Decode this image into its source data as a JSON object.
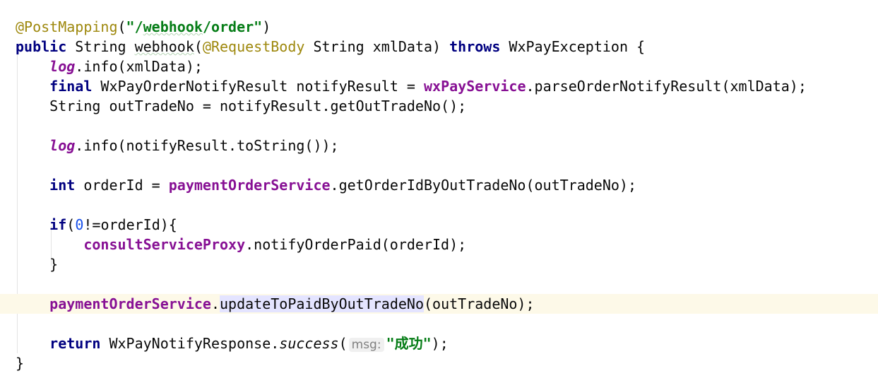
{
  "code": {
    "lines": [
      {
        "tokens": [
          {
            "t": "@PostMapping",
            "c": "ann"
          },
          {
            "t": "(",
            "c": ""
          },
          {
            "t": "\"/",
            "c": "str"
          },
          {
            "t": "webhook",
            "c": "str wavy"
          },
          {
            "t": "/order\"",
            "c": "str"
          },
          {
            "t": ")",
            "c": ""
          }
        ]
      },
      {
        "tokens": [
          {
            "t": "public",
            "c": "kw"
          },
          {
            "t": " String ",
            "c": ""
          },
          {
            "t": "webhook",
            "c": "wavy"
          },
          {
            "t": "(",
            "c": ""
          },
          {
            "t": "@RequestBody",
            "c": "ann"
          },
          {
            "t": " String xmlData) ",
            "c": ""
          },
          {
            "t": "throws",
            "c": "kw"
          },
          {
            "t": " WxPayException {",
            "c": ""
          }
        ]
      },
      {
        "tokens": [
          {
            "t": "    ",
            "c": ""
          },
          {
            "t": "log",
            "c": "ifield"
          },
          {
            "t": ".info(xmlData);",
            "c": ""
          }
        ]
      },
      {
        "tokens": [
          {
            "t": "    ",
            "c": ""
          },
          {
            "t": "final",
            "c": "kw"
          },
          {
            "t": " WxPayOrderNotifyResult notifyResult = ",
            "c": ""
          },
          {
            "t": "wxPayService",
            "c": "field"
          },
          {
            "t": ".parseOrderNotifyResult(xmlData);",
            "c": ""
          }
        ]
      },
      {
        "tokens": [
          {
            "t": "    String outTradeNo = notifyResult.getOutTradeNo();",
            "c": ""
          }
        ]
      },
      {
        "tokens": []
      },
      {
        "tokens": [
          {
            "t": "    ",
            "c": ""
          },
          {
            "t": "log",
            "c": "ifield"
          },
          {
            "t": ".info(notifyResult.toString());",
            "c": ""
          }
        ]
      },
      {
        "tokens": []
      },
      {
        "tokens": [
          {
            "t": "    ",
            "c": ""
          },
          {
            "t": "int",
            "c": "kw"
          },
          {
            "t": " orderId = ",
            "c": ""
          },
          {
            "t": "paymentOrderService",
            "c": "field"
          },
          {
            "t": ".getOrderIdByOutTradeNo(outTradeNo);",
            "c": ""
          }
        ]
      },
      {
        "tokens": []
      },
      {
        "tokens": [
          {
            "t": "    ",
            "c": ""
          },
          {
            "t": "if",
            "c": "kw"
          },
          {
            "t": "(",
            "c": ""
          },
          {
            "t": "0",
            "c": "num"
          },
          {
            "t": "!=orderId){",
            "c": ""
          }
        ]
      },
      {
        "tokens": [
          {
            "t": "        ",
            "c": ""
          },
          {
            "t": "consultServiceProxy",
            "c": "field"
          },
          {
            "t": ".notifyOrderPaid(orderId);",
            "c": ""
          }
        ]
      },
      {
        "tokens": [
          {
            "t": "    }",
            "c": ""
          }
        ]
      },
      {
        "tokens": []
      },
      {
        "current": true,
        "tokens": [
          {
            "t": "    ",
            "c": ""
          },
          {
            "t": "paymentOrderService",
            "c": "field"
          },
          {
            "t": ".",
            "c": ""
          },
          {
            "t": "updateToPaidByOutTradeNo",
            "c": "sel"
          },
          {
            "t": "(outTradeNo);",
            "c": ""
          }
        ]
      },
      {
        "tokens": []
      },
      {
        "tokens": [
          {
            "t": "    ",
            "c": ""
          },
          {
            "t": "return",
            "c": "kw"
          },
          {
            "t": " WxPayNotifyResponse.",
            "c": ""
          },
          {
            "t": "success",
            "c": "it"
          },
          {
            "t": "(",
            "c": ""
          },
          {
            "t": "msg:",
            "c": "hint"
          },
          {
            "t": "\"成功\"",
            "c": "str"
          },
          {
            "t": ");",
            "c": ""
          }
        ]
      },
      {
        "tokens": [
          {
            "t": "}",
            "c": ""
          }
        ]
      }
    ]
  }
}
